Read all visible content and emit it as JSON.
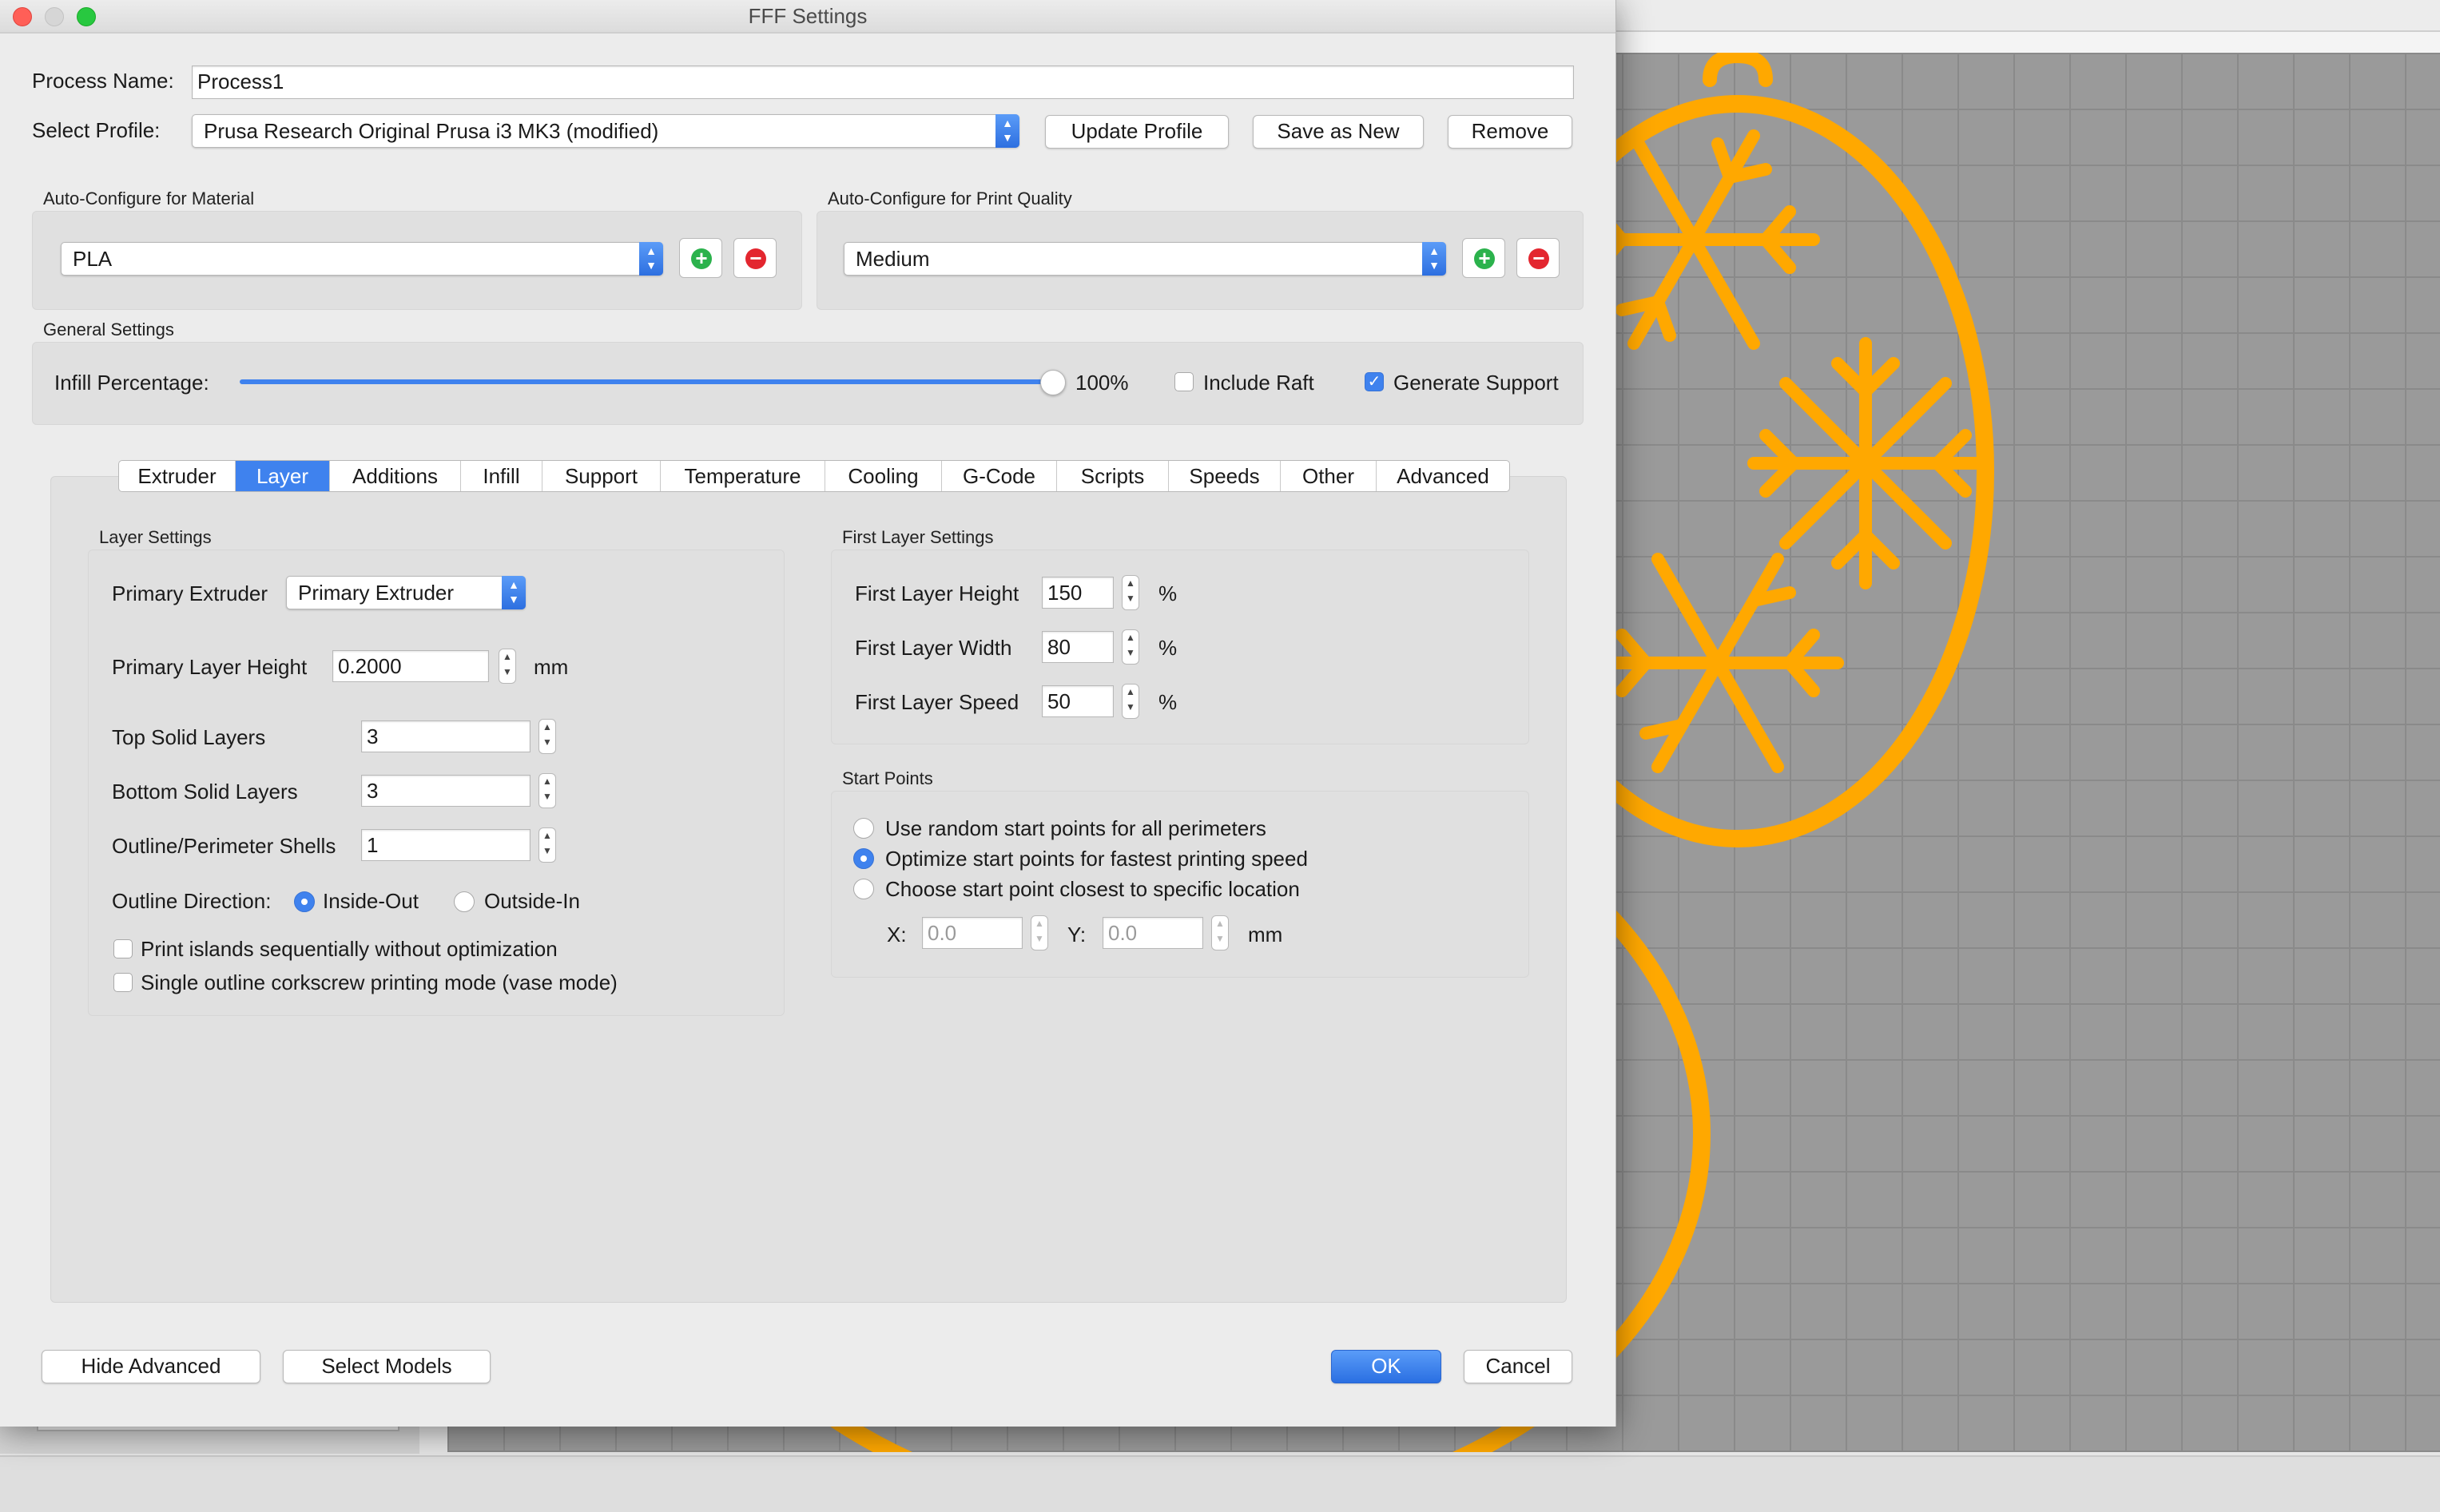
{
  "window": {
    "title": "FFF Settings"
  },
  "process": {
    "name_label": "Process Name:",
    "name_value": "Process1",
    "profile_label": "Select Profile:",
    "profile_value": "Prusa Research Original Prusa i3 MK3 (modified)",
    "update_profile": "Update Profile",
    "save_as_new": "Save as New",
    "remove": "Remove"
  },
  "material": {
    "section": "Auto-Configure for Material",
    "value": "PLA"
  },
  "quality": {
    "section": "Auto-Configure for Print Quality",
    "value": "Medium"
  },
  "general": {
    "section": "General Settings",
    "infill_label": "Infill Percentage:",
    "infill_value": "100%",
    "infill_fraction": 1.0,
    "include_raft": "Include Raft",
    "include_raft_checked": false,
    "generate_support": "Generate Support",
    "generate_support_checked": true
  },
  "tabs": [
    {
      "label": "Extruder",
      "active": false
    },
    {
      "label": "Layer",
      "active": true
    },
    {
      "label": "Additions",
      "active": false
    },
    {
      "label": "Infill",
      "active": false
    },
    {
      "label": "Support",
      "active": false
    },
    {
      "label": "Temperature",
      "active": false
    },
    {
      "label": "Cooling",
      "active": false
    },
    {
      "label": "G-Code",
      "active": false
    },
    {
      "label": "Scripts",
      "active": false
    },
    {
      "label": "Speeds",
      "active": false
    },
    {
      "label": "Other",
      "active": false
    },
    {
      "label": "Advanced",
      "active": false
    }
  ],
  "layer": {
    "section": "Layer Settings",
    "primary_extruder_label": "Primary Extruder",
    "primary_extruder_value": "Primary Extruder",
    "layer_height_label": "Primary Layer Height",
    "layer_height_value": "0.2000",
    "layer_height_unit": "mm",
    "top_solid_label": "Top Solid Layers",
    "top_solid_value": "3",
    "bottom_solid_label": "Bottom Solid Layers",
    "bottom_solid_value": "3",
    "shells_label": "Outline/Perimeter Shells",
    "shells_value": "1",
    "direction_label": "Outline Direction:",
    "inside_out": "Inside-Out",
    "outside_in": "Outside-In",
    "direction_selected": "Inside-Out",
    "print_islands": "Print islands sequentially without optimization",
    "vase_mode": "Single outline corkscrew printing mode (vase mode)"
  },
  "first_layer": {
    "section": "First Layer Settings",
    "height_label": "First Layer Height",
    "height_value": "150",
    "width_label": "First Layer Width",
    "width_value": "80",
    "speed_label": "First Layer Speed",
    "speed_value": "50",
    "unit": "%"
  },
  "start_points": {
    "section": "Start Points",
    "option_random": "Use random start points for all perimeters",
    "option_optimize": "Optimize start points for fastest printing speed",
    "option_closest": "Choose start point closest to specific location",
    "selected": "Optimize start points for fastest printing speed",
    "x_label": "X:",
    "x_value": "0.0",
    "y_label": "Y:",
    "y_value": "0.0",
    "unit": "mm"
  },
  "footer": {
    "hide_advanced": "Hide Advanced",
    "select_models": "Select Models",
    "ok": "OK",
    "cancel": "Cancel"
  },
  "colors": {
    "accent": "#3f82ee",
    "model": "#ffa800",
    "build_plate": "#9a9a9a",
    "close": "#ff5f57",
    "maximize": "#28c840",
    "add": "#2bb24c",
    "remove": "#e3262f"
  }
}
